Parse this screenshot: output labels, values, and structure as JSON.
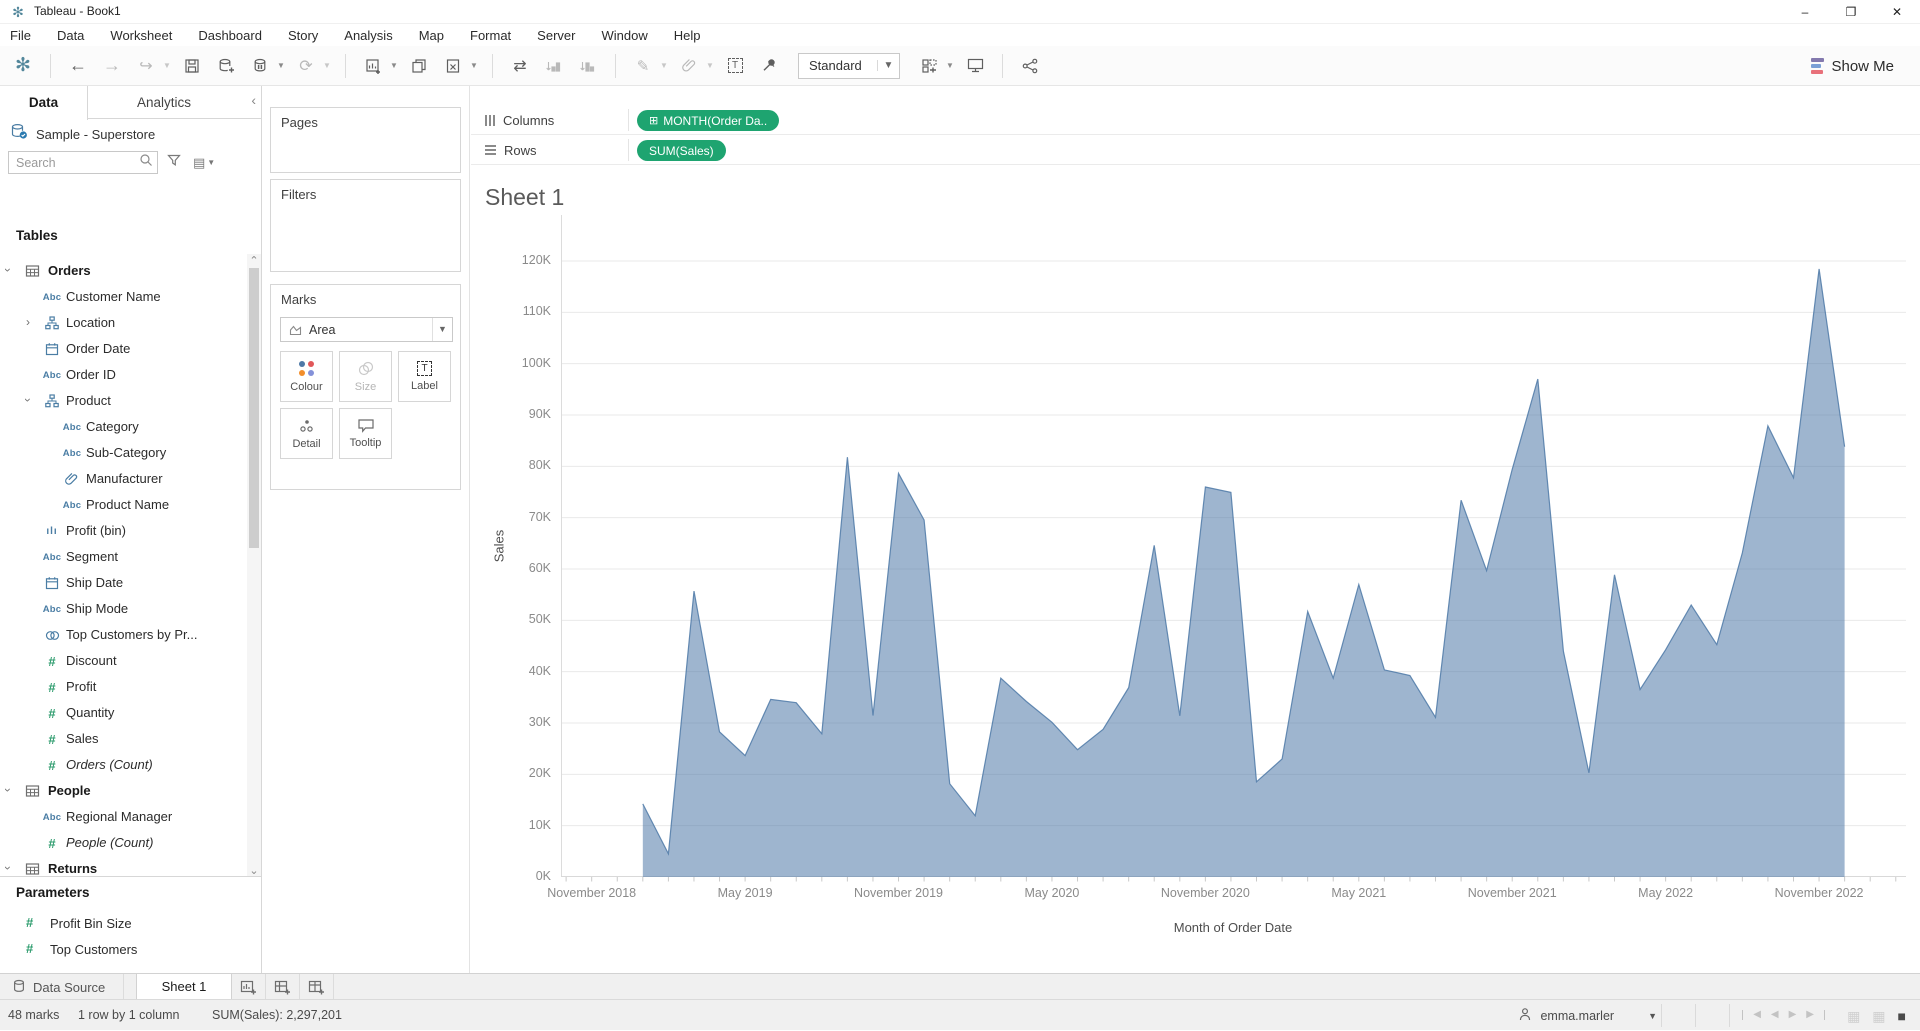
{
  "window": {
    "title": "Tableau - Book1",
    "controls": [
      "minimize",
      "maximize",
      "close"
    ]
  },
  "menu": {
    "items": [
      "File",
      "Data",
      "Worksheet",
      "Dashboard",
      "Story",
      "Analysis",
      "Map",
      "Format",
      "Server",
      "Window",
      "Help"
    ]
  },
  "toolbar": {
    "fit_label": "Standard",
    "show_me_label": "Show Me",
    "buttons": [
      {
        "name": "tableau-logo-icon",
        "icon": "logo"
      },
      {
        "name": "toolbar-separator",
        "sep": true
      },
      {
        "name": "undo-button",
        "icon": "back"
      },
      {
        "name": "redo-button",
        "icon": "forward",
        "disabled": true
      },
      {
        "name": "replay-button",
        "icon": "replay",
        "disabled": true,
        "caret": true
      },
      {
        "name": "save-button",
        "icon": "save"
      },
      {
        "name": "new-datasource-button",
        "icon": "add-data"
      },
      {
        "name": "pause-auto-updates-button",
        "icon": "pause-data",
        "caret": true
      },
      {
        "name": "run-update-button",
        "icon": "refresh",
        "disabled": true,
        "caret": true
      },
      {
        "name": "toolbar-separator",
        "sep": true
      },
      {
        "name": "new-worksheet-button",
        "icon": "new-sheet",
        "caret": true
      },
      {
        "name": "duplicate-button",
        "icon": "duplicate"
      },
      {
        "name": "clear-sheet-button",
        "icon": "clear",
        "caret": true
      },
      {
        "name": "toolbar-separator",
        "sep": true
      },
      {
        "name": "swap-rows-columns-button",
        "icon": "swap"
      },
      {
        "name": "sort-ascending-button",
        "icon": "sort-asc",
        "disabled": true
      },
      {
        "name": "sort-descending-button",
        "icon": "sort-desc",
        "disabled": true
      },
      {
        "name": "toolbar-separator",
        "sep": true
      },
      {
        "name": "highlight-button",
        "icon": "highlight",
        "disabled": true,
        "caret": true
      },
      {
        "name": "group-members-button",
        "icon": "paperclip",
        "disabled": true,
        "caret": true
      },
      {
        "name": "show-mark-labels-button",
        "icon": "label"
      },
      {
        "name": "fix-axes-button",
        "icon": "pin"
      },
      {
        "name": "fit-selector",
        "dropdown": true
      },
      {
        "name": "show-hide-cards-button",
        "icon": "cards",
        "caret": true
      },
      {
        "name": "presentation-mode-button",
        "icon": "present"
      },
      {
        "name": "toolbar-separator",
        "sep": true
      },
      {
        "name": "share-button",
        "icon": "share"
      }
    ]
  },
  "data_pane": {
    "tabs": [
      {
        "label": "Data",
        "active": true
      },
      {
        "label": "Analytics",
        "active": false
      }
    ],
    "datasource": "Sample - Superstore",
    "search_placeholder": "Search",
    "tables_header": "Tables",
    "fields": [
      {
        "label": "Orders",
        "icon": "table",
        "level": 1,
        "chevron": "down",
        "header": true
      },
      {
        "label": "Customer Name",
        "icon": "abc",
        "level": 2
      },
      {
        "label": "Location",
        "icon": "hierarchy",
        "level": 2,
        "chevron": "right"
      },
      {
        "label": "Order Date",
        "icon": "calendar",
        "level": 2
      },
      {
        "label": "Order ID",
        "icon": "abc",
        "level": 2
      },
      {
        "label": "Product",
        "icon": "hierarchy",
        "level": 2,
        "chevron": "down"
      },
      {
        "label": "Category",
        "icon": "abc",
        "level": 3
      },
      {
        "label": "Sub-Category",
        "icon": "abc",
        "level": 3
      },
      {
        "label": "Manufacturer",
        "icon": "paperclip-field",
        "level": 3
      },
      {
        "label": "Product Name",
        "icon": "abc",
        "level": 3
      },
      {
        "label": "Profit (bin)",
        "icon": "histogram",
        "level": 2
      },
      {
        "label": "Segment",
        "icon": "abc",
        "level": 2
      },
      {
        "label": "Ship Date",
        "icon": "calendar",
        "level": 2
      },
      {
        "label": "Ship Mode",
        "icon": "abc",
        "level": 2
      },
      {
        "label": "Top Customers by Pr...",
        "icon": "set",
        "level": 2
      },
      {
        "label": "Discount",
        "icon": "hash",
        "level": 2
      },
      {
        "label": "Profit",
        "icon": "hash",
        "level": 2
      },
      {
        "label": "Quantity",
        "icon": "hash",
        "level": 2
      },
      {
        "label": "Sales",
        "icon": "hash",
        "level": 2
      },
      {
        "label": "Orders (Count)",
        "icon": "hash",
        "level": 2,
        "italic": true
      },
      {
        "label": "People",
        "icon": "table",
        "level": 1,
        "chevron": "down",
        "header": true
      },
      {
        "label": "Regional Manager",
        "icon": "abc",
        "level": 2
      },
      {
        "label": "People (Count)",
        "icon": "hash",
        "level": 2,
        "italic": true
      },
      {
        "label": "Returns",
        "icon": "table",
        "level": 1,
        "chevron": "down",
        "header": true
      }
    ],
    "parameters_header": "Parameters",
    "parameters": [
      {
        "label": "Profit Bin Size"
      },
      {
        "label": "Top Customers"
      }
    ]
  },
  "cards": {
    "pages_title": "Pages",
    "filters_title": "Filters",
    "marks_title": "Marks",
    "mark_type": "Area",
    "buttons": [
      {
        "label": "Colour",
        "icon": "color-dots",
        "disabled": false
      },
      {
        "label": "Size",
        "icon": "size-circles",
        "disabled": true
      },
      {
        "label": "Label",
        "icon": "label",
        "disabled": false
      },
      {
        "label": "Detail",
        "icon": "detail-dots",
        "disabled": false
      },
      {
        "label": "Tooltip",
        "icon": "tooltip-bubble",
        "disabled": false
      }
    ]
  },
  "shelves": {
    "columns_label": "Columns",
    "rows_label": "Rows",
    "columns_pill": "MONTH(Order Da..",
    "rows_pill": "SUM(Sales)"
  },
  "sheet": {
    "title": "Sheet 1"
  },
  "chart_data": {
    "type": "area",
    "series_name": "SUM(Sales)",
    "title": "Sheet 1",
    "xlabel": "Month of Order Date",
    "ylabel": "Sales",
    "ylim": [
      0,
      120000
    ],
    "grid": "horizontal",
    "categories": [
      "Jan 2019",
      "Feb 2019",
      "Mar 2019",
      "Apr 2019",
      "May 2019",
      "Jun 2019",
      "Jul 2019",
      "Aug 2019",
      "Sep 2019",
      "Oct 2019",
      "Nov 2019",
      "Dec 2019",
      "Jan 2020",
      "Feb 2020",
      "Mar 2020",
      "Apr 2020",
      "May 2020",
      "Jun 2020",
      "Jul 2020",
      "Aug 2020",
      "Sep 2020",
      "Oct 2020",
      "Nov 2020",
      "Dec 2020",
      "Jan 2021",
      "Feb 2021",
      "Mar 2021",
      "Apr 2021",
      "May 2021",
      "Jun 2021",
      "Jul 2021",
      "Aug 2021",
      "Sep 2021",
      "Oct 2021",
      "Nov 2021",
      "Dec 2021",
      "Jan 2022",
      "Feb 2022",
      "Mar 2022",
      "Apr 2022",
      "May 2022",
      "Jun 2022",
      "Jul 2022",
      "Aug 2022",
      "Sep 2022",
      "Oct 2022",
      "Nov 2022",
      "Dec 2022"
    ],
    "values": [
      14237,
      4520,
      55691,
      28295,
      23648,
      34595,
      33946,
      27909,
      81777,
      31453,
      78629,
      69545,
      18174,
      11951,
      38726,
      34195,
      30131,
      24797,
      28765,
      36898,
      64595,
      31404,
      75973,
      74920,
      18542,
      22978,
      51715,
      38750,
      56988,
      40344,
      39261,
      31115,
      73410,
      59687,
      79412,
      96999,
      43971,
      20301,
      58872,
      36522,
      44261,
      52981,
      45264,
      63121,
      87867,
      77777,
      118448,
      83829
    ],
    "yticks": [
      {
        "label": "0K",
        "value": 0
      },
      {
        "label": "10K",
        "value": 10000
      },
      {
        "label": "20K",
        "value": 20000
      },
      {
        "label": "30K",
        "value": 30000
      },
      {
        "label": "40K",
        "value": 40000
      },
      {
        "label": "50K",
        "value": 50000
      },
      {
        "label": "60K",
        "value": 60000
      },
      {
        "label": "70K",
        "value": 70000
      },
      {
        "label": "80K",
        "value": 80000
      },
      {
        "label": "90K",
        "value": 90000
      },
      {
        "label": "100K",
        "value": 100000
      },
      {
        "label": "110K",
        "value": 110000
      },
      {
        "label": "120K",
        "value": 120000
      }
    ],
    "xticks": [
      {
        "label": "November 2018",
        "month_index": -2
      },
      {
        "label": "May 2019",
        "month_index": 4
      },
      {
        "label": "November 2019",
        "month_index": 10
      },
      {
        "label": "May 2020",
        "month_index": 16
      },
      {
        "label": "November 2020",
        "month_index": 22
      },
      {
        "label": "May 2021",
        "month_index": 28
      },
      {
        "label": "November 2021",
        "month_index": 34
      },
      {
        "label": "May 2022",
        "month_index": 40
      },
      {
        "label": "November 2022",
        "month_index": 46
      }
    ],
    "colors": {
      "area_fill": "#4e79a7",
      "area_fill_opacity": 0.55,
      "area_line": "#4e79a7"
    }
  },
  "tabs_bar": {
    "data_source_label": "Data Source",
    "sheets": [
      {
        "label": "Sheet 1",
        "active": true
      }
    ]
  },
  "status_bar": {
    "marks_count": "48 marks",
    "layout": "1 row by 1 column",
    "aggregate": "SUM(Sales): 2,297,201",
    "user": "emma.marler"
  },
  "colors": {
    "pill_green": "#1ea470",
    "dimension_blue": "#4a7da4",
    "measure_green": "#2e9c6e"
  }
}
